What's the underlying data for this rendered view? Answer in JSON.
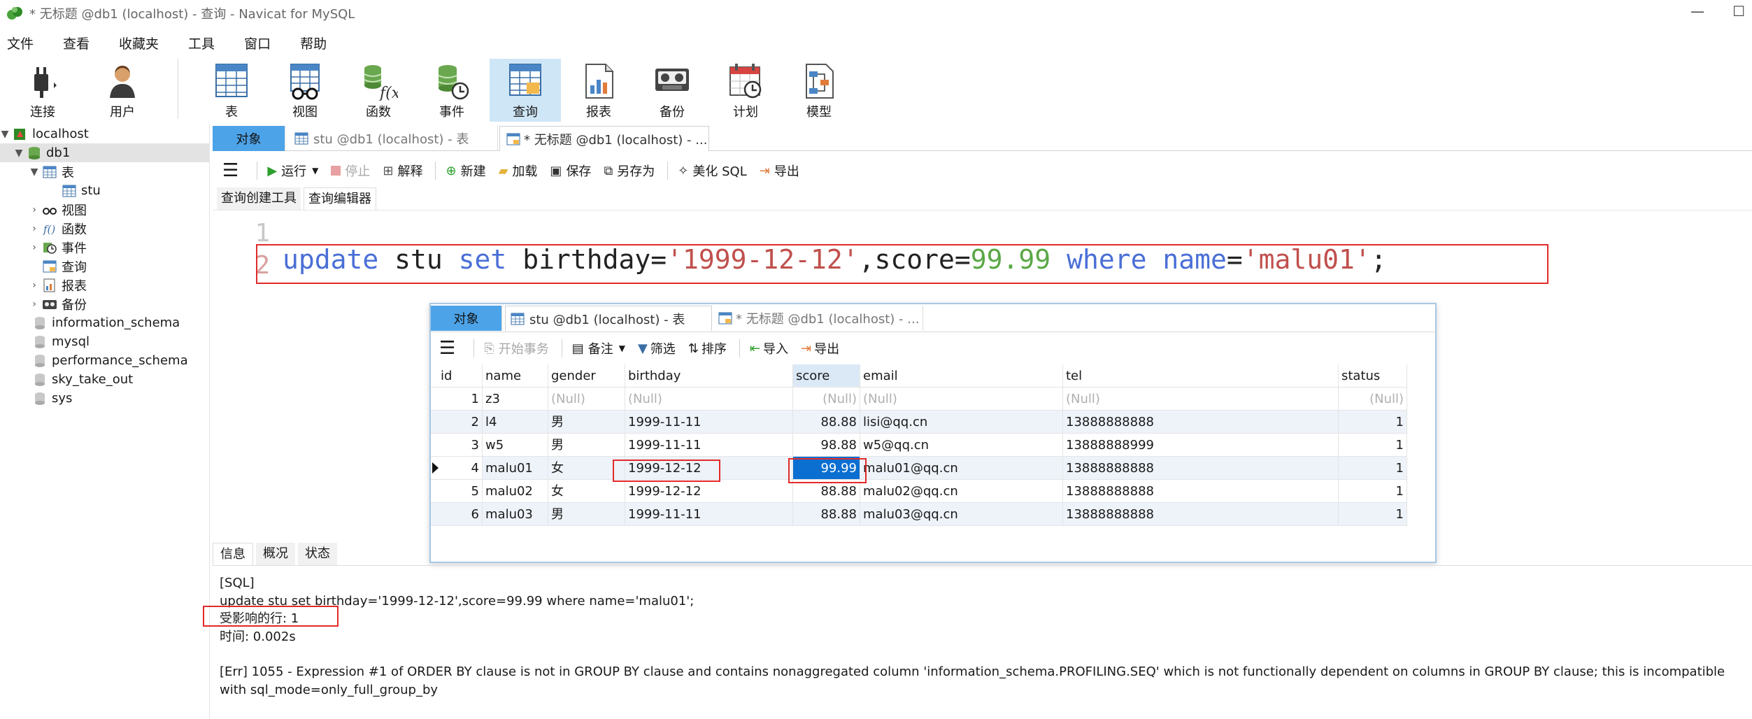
{
  "window": {
    "title": "* 无标题 @db1 (localhost) - 查询 - Navicat for MySQL",
    "minimize": "—",
    "maximize": "☐"
  },
  "menu": [
    "文件",
    "查看",
    "收藏夹",
    "工具",
    "窗口",
    "帮助"
  ],
  "toolbar": {
    "connect": "连接",
    "user": "用户",
    "table": "表",
    "view": "视图",
    "function": "函数",
    "event": "事件",
    "query": "查询",
    "report": "报表",
    "backup": "备份",
    "schedule": "计划",
    "model": "模型"
  },
  "tree": {
    "connection": "localhost",
    "db": "db1",
    "tables": "表",
    "table_stu": "stu",
    "views": "视图",
    "functions": "函数",
    "events": "事件",
    "queries": "查询",
    "reports": "报表",
    "backups": "备份",
    "databases": [
      "information_schema",
      "mysql",
      "performance_schema",
      "sky_take_out",
      "sys"
    ]
  },
  "tabs": {
    "objects": "对象",
    "stu_table": "stu @db1 (localhost) - 表",
    "query": "* 无标题 @db1 (localhost) - ..."
  },
  "query_toolbar": {
    "run": "运行",
    "stop": "停止",
    "explain": "解释",
    "new": "新建",
    "load": "加载",
    "save": "保存",
    "save_as": "另存为",
    "beautify": "美化 SQL",
    "export": "导出"
  },
  "subtabs": {
    "builder": "查询创建工具",
    "editor": "查询编辑器"
  },
  "editor": {
    "line1": "1",
    "line2": "2",
    "sql": {
      "kw_update": "update",
      "t1": " stu ",
      "kw_set": "set",
      "t2": " birthday=",
      "s1": "'1999-12-12'",
      "t3": ",score=",
      "n1": "99.99",
      "t4": " ",
      "kw_where": "where",
      "t5": " ",
      "kw_name": "name",
      "t6": "=",
      "s2": "'malu01'",
      "t7": ";"
    }
  },
  "overlay": {
    "tabs": {
      "objects": "对象",
      "stu_table": "stu @db1 (localhost) - 表",
      "query": "* 无标题 @db1 (localhost) - ..."
    },
    "toolbar": {
      "begin_tx": "开始事务",
      "memo": "备注",
      "filter": "筛选",
      "sort": "排序",
      "import": "导入",
      "export": "导出"
    },
    "columns": [
      "id",
      "name",
      "gender",
      "birthday",
      "score",
      "email",
      "tel",
      "status"
    ],
    "rows": [
      [
        "1",
        "z3",
        "(Null)",
        "(Null)",
        "(Null)",
        "(Null)",
        "(Null)",
        "(Null)"
      ],
      [
        "2",
        "l4",
        "男",
        "1999-11-11",
        "88.88",
        "lisi@qq.cn",
        "13888888888",
        "1"
      ],
      [
        "3",
        "w5",
        "男",
        "1999-11-11",
        "98.88",
        "w5@qq.cn",
        "13888888999",
        "1"
      ],
      [
        "4",
        "malu01",
        "女",
        "1999-12-12",
        "99.99",
        "malu01@qq.cn",
        "13888888888",
        "1"
      ],
      [
        "5",
        "malu02",
        "女",
        "1999-12-12",
        "88.88",
        "malu02@qq.cn",
        "13888888888",
        "1"
      ],
      [
        "6",
        "malu03",
        "男",
        "1999-11-11",
        "88.88",
        "malu03@qq.cn",
        "13888888888",
        "1"
      ]
    ]
  },
  "info_tabs": {
    "info": "信息",
    "profile": "概况",
    "status": "状态"
  },
  "info": {
    "sql_tag": "[SQL]",
    "sql_text": "update stu set birthday='1999-12-12',score=99.99 where name='malu01';",
    "affected": "受影响的行: 1",
    "time": "时间: 0.002s",
    "error": "[Err] 1055 - Expression #1 of ORDER BY clause is not in GROUP BY clause and contains nonaggregated column 'information_schema.PROFILING.SEQ' which is not functionally dependent on columns in GROUP BY clause; this is incompatible with sql_mode=only_full_group_by"
  },
  "colors": {
    "accent": "#4da3e8",
    "selection": "#0a6fd1",
    "highlight_box": "#e22a2a",
    "keyword": "#4a6fd6",
    "string": "#c0504d",
    "number": "#5aa846"
  }
}
